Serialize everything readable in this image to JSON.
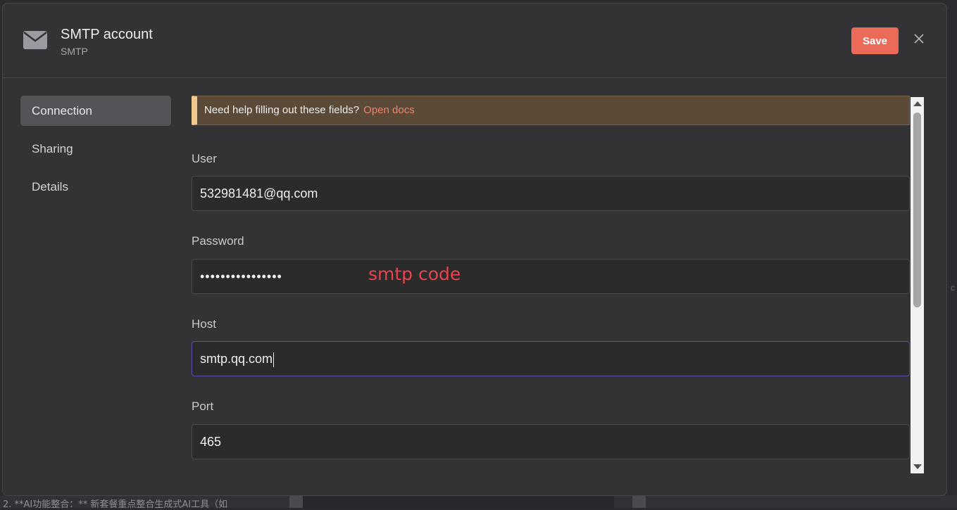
{
  "background": {
    "bottom_text": "2. **AI功能整合：** 新套餐重点整合生成式AI工具（如",
    "right_char": "c"
  },
  "header": {
    "icon": "envelope-icon",
    "title": "SMTP account",
    "subtitle": "SMTP",
    "save_label": "Save",
    "close_icon": "close-icon"
  },
  "sidebar": {
    "items": [
      {
        "label": "Connection",
        "active": true
      },
      {
        "label": "Sharing",
        "active": false
      },
      {
        "label": "Details",
        "active": false
      }
    ]
  },
  "notice": {
    "text": "Need help filling out these fields?",
    "link": "Open docs"
  },
  "form": {
    "user": {
      "label": "User",
      "value": "532981481@qq.com"
    },
    "password": {
      "label": "Password",
      "value": "••••••••••••••••",
      "annotation": "smtp code"
    },
    "host": {
      "label": "Host",
      "value": "smtp.qq.com"
    },
    "port": {
      "label": "Port",
      "value": "465"
    }
  },
  "colors": {
    "accent": "#ec6a58",
    "notice_bg": "#5a4a37",
    "notice_bar": "#f2c88e",
    "focus_border": "#5a4fa8",
    "annotation": "#e8434f"
  }
}
